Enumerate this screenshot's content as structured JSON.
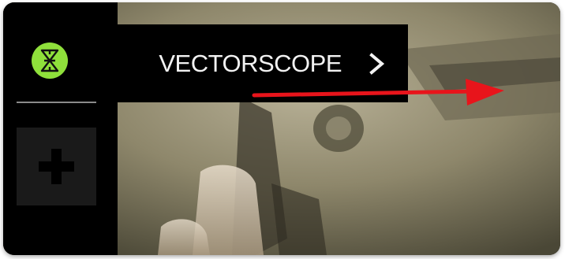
{
  "panel": {
    "tool_label": "VECTORSCOPE"
  },
  "icons": {
    "tool": "vectorscope-icon",
    "next": "chevron-right-icon",
    "add": "plus-icon"
  },
  "colors": {
    "accent_green": "#8fe03b",
    "annotation_red": "#e8141b",
    "sidebar": "#000000",
    "add_button": "#1a1a1a"
  }
}
